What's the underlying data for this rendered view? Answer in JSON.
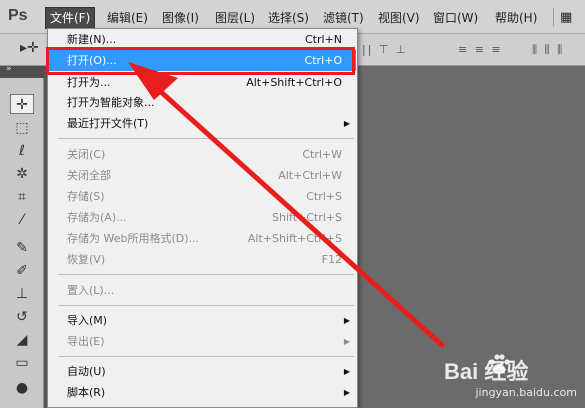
{
  "app": {
    "logo": "Ps"
  },
  "menubar": [
    {
      "label": "文件(F)",
      "active": true
    },
    {
      "label": "编辑(E)"
    },
    {
      "label": "图像(I)"
    },
    {
      "label": "图层(L)"
    },
    {
      "label": "选择(S)"
    },
    {
      "label": "滤镜(T)"
    },
    {
      "label": "视图(V)"
    },
    {
      "label": "窗口(W)"
    },
    {
      "label": "帮助(H)"
    }
  ],
  "file_menu": [
    {
      "label": "新建(N)...",
      "shortcut": "Ctrl+N",
      "state": "enabled"
    },
    {
      "label": "打开(O)...",
      "shortcut": "Ctrl+O",
      "state": "highlight"
    },
    {
      "label": "打开为...",
      "shortcut": "Alt+Shift+Ctrl+O",
      "state": "enabled"
    },
    {
      "label": "打开为智能对象...",
      "shortcut": "",
      "state": "enabled"
    },
    {
      "label": "最近打开文件(T)",
      "shortcut": "",
      "state": "enabled",
      "submenu": true
    },
    {
      "label": "关闭(C)",
      "shortcut": "Ctrl+W",
      "state": "disabled"
    },
    {
      "label": "关闭全部",
      "shortcut": "Alt+Ctrl+W",
      "state": "disabled"
    },
    {
      "label": "存储(S)",
      "shortcut": "Ctrl+S",
      "state": "disabled"
    },
    {
      "label": "存储为(A)...",
      "shortcut": "Shift+Ctrl+S",
      "state": "disabled"
    },
    {
      "label": "存储为 Web所用格式(D)...",
      "shortcut": "Alt+Shift+Ctrl+S",
      "state": "disabled"
    },
    {
      "label": "恢复(V)",
      "shortcut": "F12",
      "state": "disabled"
    },
    {
      "label": "置入(L)...",
      "shortcut": "",
      "state": "disabled"
    },
    {
      "label": "导入(M)",
      "shortcut": "",
      "state": "enabled",
      "submenu": true
    },
    {
      "label": "导出(E)",
      "shortcut": "",
      "state": "disabled",
      "submenu": true
    },
    {
      "label": "自动(U)",
      "shortcut": "",
      "state": "enabled",
      "submenu": true
    },
    {
      "label": "脚本(R)",
      "shortcut": "",
      "state": "enabled",
      "submenu": true
    }
  ],
  "icons": {
    "submenu_arrow": "▶",
    "tools": [
      "move-tool-icon",
      "marquee-tool-icon",
      "lasso-tool-icon",
      "magic-wand-tool-icon",
      "crop-tool-icon",
      "eyedropper-tool-icon",
      "healing-brush-tool-icon",
      "brush-tool-icon",
      "clone-stamp-tool-icon",
      "history-brush-tool-icon",
      "eraser-tool-icon",
      "gradient-tool-icon",
      "blur-tool-icon"
    ]
  },
  "colors": {
    "highlight": "#3399ff",
    "annotation_red": "#e81e1e",
    "canvas_gray": "#6b6b6b"
  },
  "watermark": {
    "brand": "Bai  经验",
    "url": "jingyan.baidu.com"
  }
}
